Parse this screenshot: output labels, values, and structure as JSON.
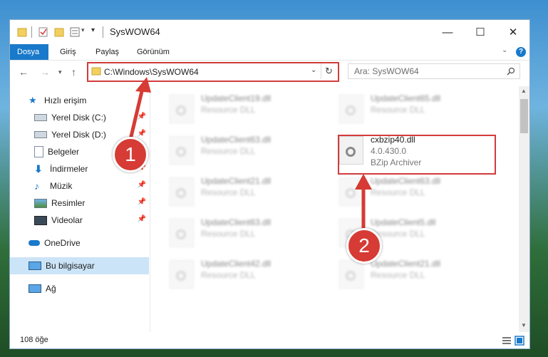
{
  "window": {
    "title": "SysWOW64",
    "controls": {
      "minimize": "—",
      "maximize": "☐",
      "close": "✕"
    }
  },
  "ribbon": {
    "tabs": [
      "Dosya",
      "Giriş",
      "Paylaş",
      "Görünüm"
    ],
    "help": "?"
  },
  "address": {
    "path": "C:\\Windows\\SysWOW64",
    "search_placeholder": "Ara: SysWOW64"
  },
  "sidebar": {
    "items": [
      {
        "label": "Hızlı erişim",
        "icon": "star-icon"
      },
      {
        "label": "Yerel Disk (C:)",
        "icon": "drive-icon",
        "pinned": true
      },
      {
        "label": "Yerel Disk (D:)",
        "icon": "drive-icon",
        "pinned": true
      },
      {
        "label": "Belgeler",
        "icon": "documents-icon",
        "pinned": true
      },
      {
        "label": "İndirmeler",
        "icon": "download-icon",
        "pinned": true
      },
      {
        "label": "Müzik",
        "icon": "music-icon",
        "pinned": true
      },
      {
        "label": "Resimler",
        "icon": "pictures-icon",
        "pinned": true
      },
      {
        "label": "Videolar",
        "icon": "video-icon",
        "pinned": true
      },
      {
        "label": "OneDrive",
        "icon": "cloud-icon"
      },
      {
        "label": "Bu bilgisayar",
        "icon": "computer-icon",
        "selected": true
      },
      {
        "label": "Ağ",
        "icon": "network-icon"
      }
    ]
  },
  "files": {
    "left": [
      {
        "name": "UpdateClient19.dll",
        "desc": "Resource DLL"
      },
      {
        "name": "UpdateClient63.dll",
        "desc": "Resource DLL"
      },
      {
        "name": "UpdateClient21.dll",
        "desc": "Resource DLL"
      },
      {
        "name": "UpdateClient63.dll",
        "desc": "Resource DLL"
      },
      {
        "name": "UpdateClient42.dll",
        "desc": "Resource DLL"
      }
    ],
    "right": [
      {
        "name": "UpdateClient65.dll",
        "desc": "Resource DLL"
      },
      {
        "name": "UpdateClient63.dll",
        "desc": "Resource DLL"
      },
      {
        "name": "UpdateClient5.dll",
        "desc": "Resource DLL"
      },
      {
        "name": "UpdateClient21.dll",
        "desc": "Resource DLL"
      }
    ],
    "highlighted": {
      "name": "cxbzip40.dll",
      "version": "4.0.430.0",
      "desc": "BZip Archiver"
    }
  },
  "status": {
    "count": "108 öğe"
  },
  "annotations": {
    "one": "1",
    "two": "2"
  },
  "colors": {
    "accent": "#1979ca",
    "annotation": "#d63b35"
  }
}
